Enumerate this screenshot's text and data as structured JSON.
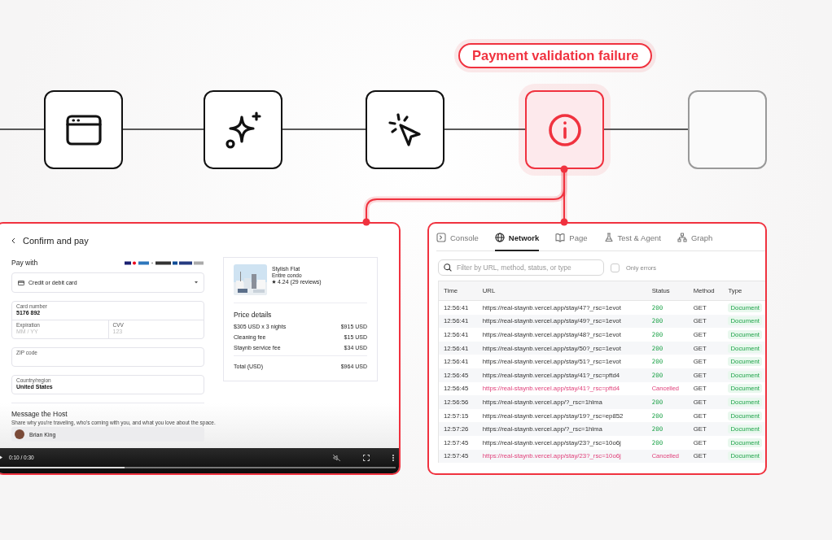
{
  "timeline": {
    "steps": [
      {
        "kind": "browser"
      },
      {
        "kind": "sparkle"
      },
      {
        "kind": "click"
      },
      {
        "kind": "error"
      },
      {
        "kind": "empty"
      }
    ],
    "callout": "Payment validation failure"
  },
  "video": {
    "title": "Confirm and pay",
    "pay_with": "Pay with",
    "payment_method": "Credit or debit card",
    "card_number": {
      "label": "Card number",
      "value": "5176 892"
    },
    "expiration": {
      "label": "Expiration",
      "placeholder": "MM / YY"
    },
    "cvv": {
      "label": "CVV",
      "placeholder": "123"
    },
    "zip": {
      "label": "ZIP code"
    },
    "country": {
      "label": "Country/region",
      "value": "United States"
    },
    "message_heading": "Message the Host",
    "message_text": "Share why you're traveling, who's coming with you, and what you love about the space.",
    "host": "Brian King",
    "listing": {
      "title": "Stylish Flat",
      "subtitle": "Entire condo",
      "rating": "4.24 (29 reviews)"
    },
    "price_heading": "Price details",
    "prices": [
      {
        "label": "$305 USD x 3 nights",
        "amount": "$915 USD"
      },
      {
        "label": "Cleaning fee",
        "amount": "$15 USD"
      },
      {
        "label": "Staynb service fee",
        "amount": "$34 USD"
      }
    ],
    "total": {
      "label": "Total (USD)",
      "amount": "$964 USD"
    },
    "player": {
      "time": "0:10 / 0:30",
      "level": 0.32
    }
  },
  "network": {
    "tabs": [
      {
        "label": "Console",
        "kind": "console",
        "selected": false
      },
      {
        "label": "Network",
        "kind": "network",
        "selected": true
      },
      {
        "label": "Page",
        "kind": "page",
        "selected": false
      },
      {
        "label": "Test & Agent",
        "kind": "test",
        "selected": false
      },
      {
        "label": "Graph",
        "kind": "graph",
        "selected": false
      }
    ],
    "search": {
      "placeholder": "Filter by URL, method, status, or type"
    },
    "only_errors": {
      "label": "Only errors",
      "checked": false
    },
    "columns": [
      "Time",
      "URL",
      "Status",
      "Method",
      "Type"
    ],
    "rows": [
      {
        "time": "12:56:41",
        "url": "https://real-staynb.vercel.app/stay/47?_rsc=1evot",
        "status": "200",
        "method": "GET",
        "type": "Document",
        "kind": "ok"
      },
      {
        "time": "12:56:41",
        "url": "https://real-staynb.vercel.app/stay/49?_rsc=1evot",
        "status": "200",
        "method": "GET",
        "type": "Document",
        "kind": "ok"
      },
      {
        "time": "12:56:41",
        "url": "https://real-staynb.vercel.app/stay/48?_rsc=1evot",
        "status": "200",
        "method": "GET",
        "type": "Document",
        "kind": "ok"
      },
      {
        "time": "12:56:41",
        "url": "https://real-staynb.vercel.app/stay/50?_rsc=1evot",
        "status": "200",
        "method": "GET",
        "type": "Document",
        "kind": "ok"
      },
      {
        "time": "12:56:41",
        "url": "https://real-staynb.vercel.app/stay/51?_rsc=1evot",
        "status": "200",
        "method": "GET",
        "type": "Document",
        "kind": "ok"
      },
      {
        "time": "12:56:45",
        "url": "https://real-staynb.vercel.app/stay/41?_rsc=pftd4",
        "status": "200",
        "method": "GET",
        "type": "Document",
        "kind": "ok"
      },
      {
        "time": "12:56:45",
        "url": "https://real-staynb.vercel.app/stay/41?_rsc=pftd4",
        "status": "Cancelled",
        "method": "GET",
        "type": "Document",
        "kind": "cancelled"
      },
      {
        "time": "12:56:56",
        "url": "https://real-staynb.vercel.app/?_rsc=1hlma",
        "status": "200",
        "method": "GET",
        "type": "Document",
        "kind": "ok"
      },
      {
        "time": "12:57:15",
        "url": "https://real-staynb.vercel.app/stay/19?_rsc=ep852",
        "status": "200",
        "method": "GET",
        "type": "Document",
        "kind": "ok"
      },
      {
        "time": "12:57:26",
        "url": "https://real-staynb.vercel.app/?_rsc=1hlma",
        "status": "200",
        "method": "GET",
        "type": "Document",
        "kind": "ok"
      },
      {
        "time": "12:57:45",
        "url": "https://real-staynb.vercel.app/stay/23?_rsc=10o6j",
        "status": "200",
        "method": "GET",
        "type": "Document",
        "kind": "ok"
      },
      {
        "time": "12:57:45",
        "url": "https://real-staynb.vercel.app/stay/23?_rsc=10o6j",
        "status": "Cancelled",
        "method": "GET",
        "type": "Document",
        "kind": "cancelled"
      }
    ]
  }
}
